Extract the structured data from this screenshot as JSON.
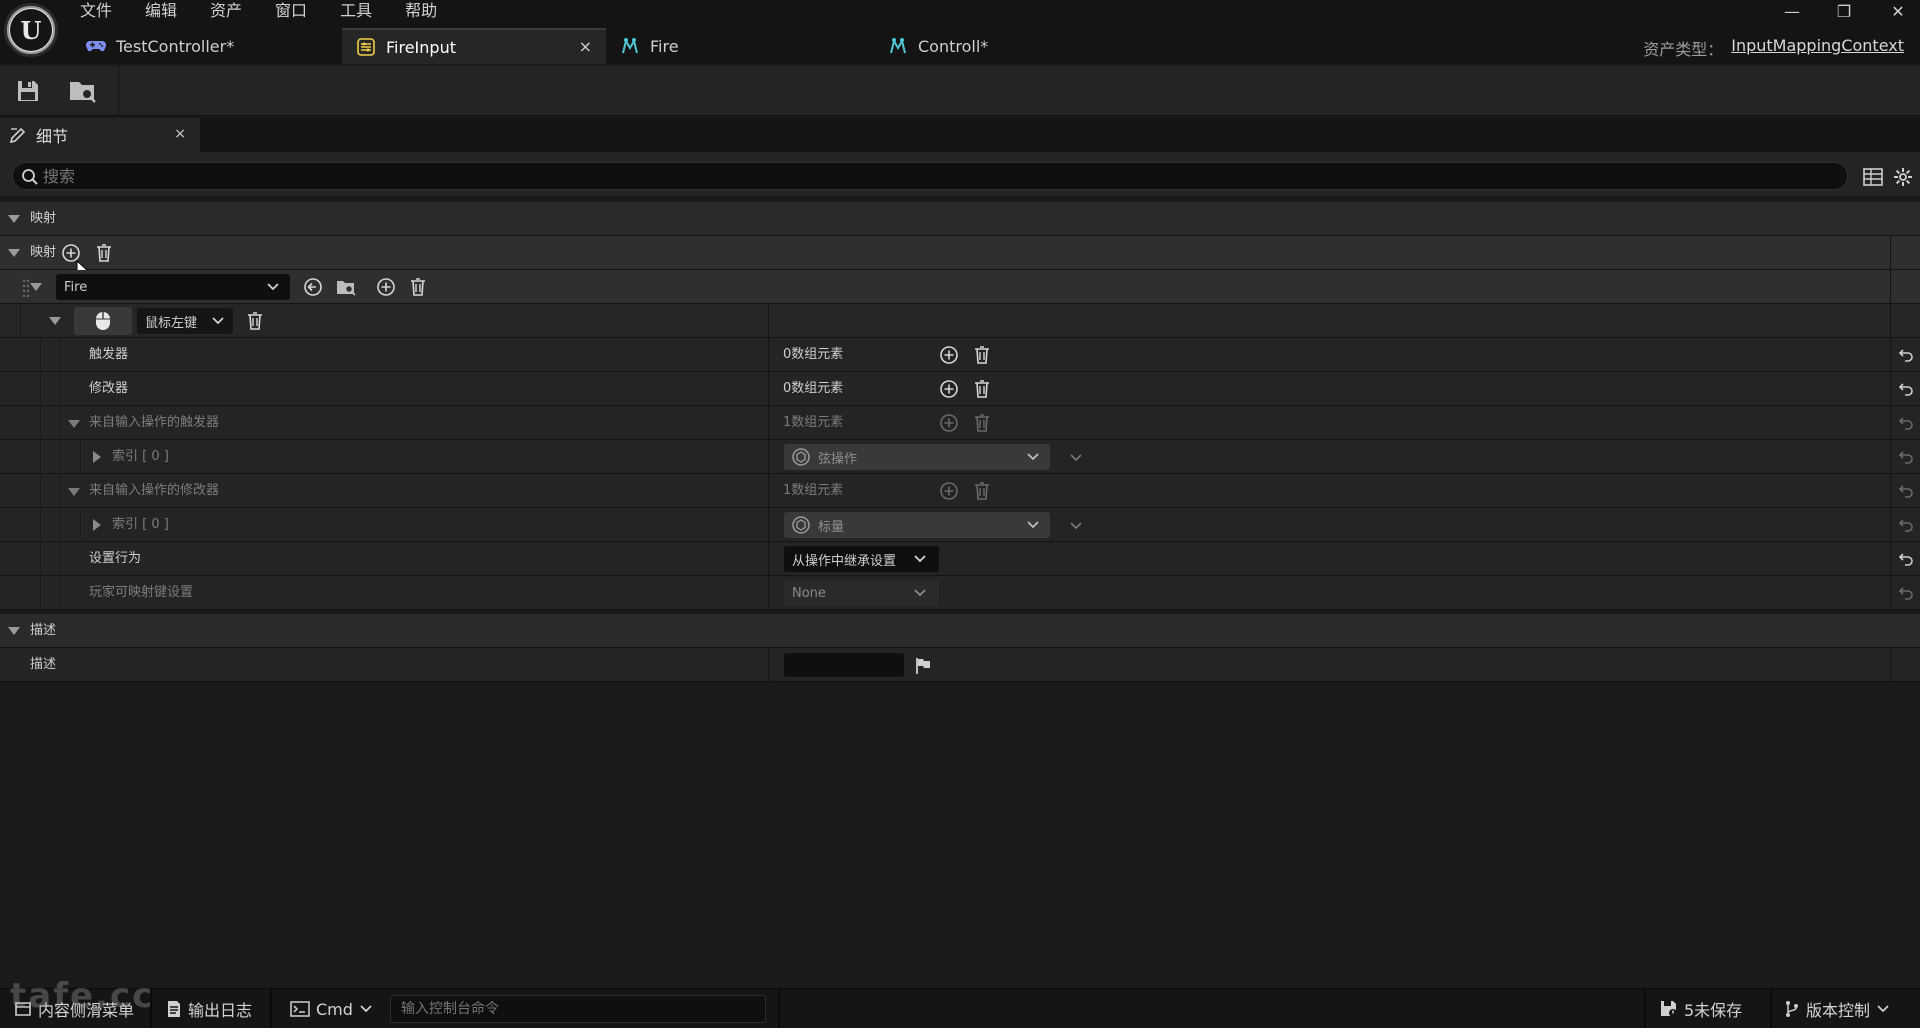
{
  "menu": [
    "文件",
    "编辑",
    "资产",
    "窗口",
    "工具",
    "帮助"
  ],
  "window_controls": {
    "minimize": "—",
    "restore": "❐",
    "close": "✕"
  },
  "tabs": [
    {
      "label": "TestController*",
      "icon": "gamepad-icon"
    },
    {
      "label": "FireInput",
      "icon": "input-mapping-icon",
      "close": "×"
    },
    {
      "label": "Fire",
      "icon": "input-action-icon"
    },
    {
      "label": "Controll*",
      "icon": "input-action-icon"
    }
  ],
  "asset_type": {
    "label": "资产类型：",
    "value": "InputMappingContext"
  },
  "details_tab": {
    "label": "细节",
    "close": "×"
  },
  "search": {
    "placeholder": "搜索"
  },
  "sections": {
    "mapping_category": "映射",
    "mappings_label": "映射",
    "description_category": "描述"
  },
  "mapping": {
    "action_value": "Fire",
    "key_value": "鼠标左键",
    "rows": {
      "triggers": {
        "label": "触发器",
        "value": "0数组元素"
      },
      "modifiers": {
        "label": "修改器",
        "value": "0数组元素"
      },
      "action_triggers": {
        "label": "来自输入操作的触发器",
        "value": "1数组元素"
      },
      "action_triggers_index": {
        "label": "索引 [ 0 ]",
        "value": "弦操作"
      },
      "action_modifiers": {
        "label": "来自输入操作的修改器",
        "value": "1数组元素"
      },
      "action_modifiers_index": {
        "label": "索引 [ 0 ]",
        "value": "标量"
      },
      "setting_behavior": {
        "label": "设置行为",
        "value": "从操作中继承设置"
      },
      "player_mappable": {
        "label": "玩家可映射键设置",
        "value": "None"
      }
    }
  },
  "description": {
    "label": "描述",
    "value": ""
  },
  "statusbar": {
    "content_drawer": "内容侧滑菜单",
    "output_log": "输出日志",
    "cmd": "Cmd",
    "console_placeholder": "输入控制台命令",
    "unsaved": "5未保存",
    "version_control": "版本控制"
  },
  "watermark": "tafe.cc",
  "colors": {
    "background": "#1a1a1a",
    "panel": "#242424",
    "input": "#0f0f0f",
    "text": "#c8c8c8"
  }
}
